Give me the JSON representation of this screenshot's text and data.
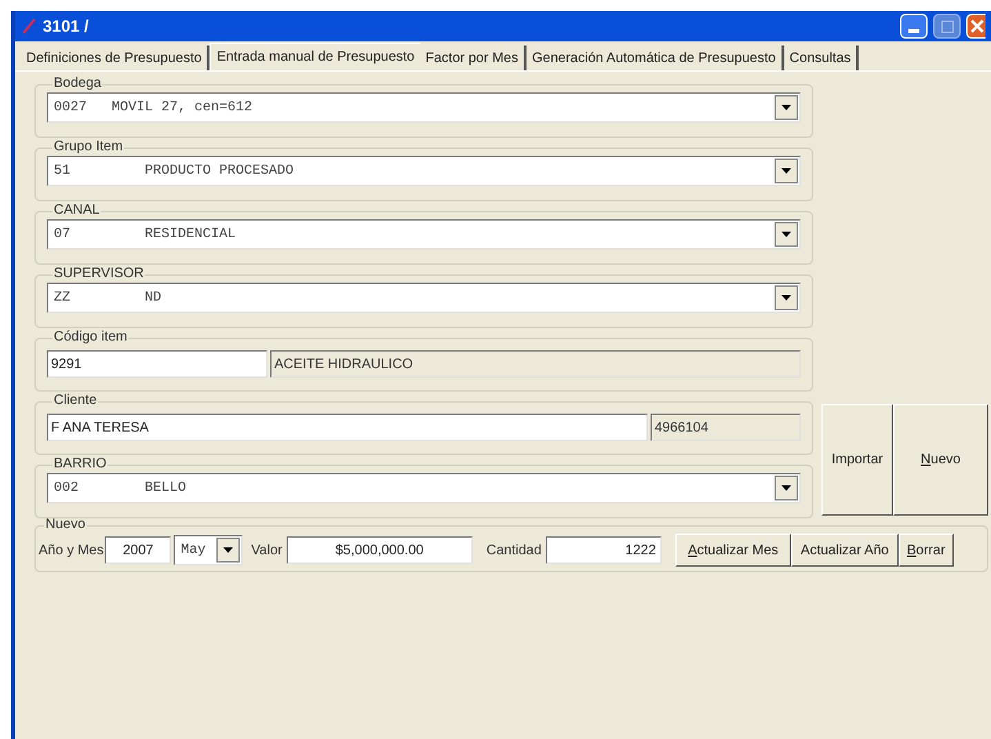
{
  "window": {
    "title": "3101 /"
  },
  "tabs": [
    {
      "label": "Definiciones de Presupuesto",
      "selected": false
    },
    {
      "label": "Entrada manual de Presupuesto",
      "selected": true
    },
    {
      "label": "Factor por Mes",
      "selected": false
    },
    {
      "label": "Generación Automática de Presupuesto",
      "selected": false
    },
    {
      "label": "Consultas",
      "selected": false
    }
  ],
  "groups": [
    {
      "kind": "combo",
      "label": "Bodega",
      "value": "0027   MOVIL 27, cen=612"
    },
    {
      "kind": "combo",
      "label": "Grupo Item",
      "value": "51         PRODUCTO PROCESADO"
    },
    {
      "kind": "combo",
      "label": "CANAL",
      "value": "07         RESIDENCIAL"
    },
    {
      "kind": "combo",
      "label": "SUPERVISOR",
      "value": "ZZ         ND"
    },
    {
      "kind": "pair",
      "label": "Código item",
      "value": "9291",
      "detail": "ACEITE HIDRAULICO",
      "wide": false
    },
    {
      "kind": "pair",
      "label": "Cliente",
      "value": "F ANA TERESA",
      "detail": "4966104",
      "wide": true
    },
    {
      "kind": "combo",
      "label": "BARRIO",
      "value": "002        BELLO"
    }
  ],
  "side_buttons": [
    {
      "rest": "Importar"
    },
    {
      "accel": "N",
      "rest": "uevo"
    }
  ],
  "nuevo": {
    "label": "Nuevo",
    "year_label": "Año y Mes",
    "year": "2007",
    "month": "May",
    "valor_label": "Valor",
    "valor": "$5,000,000.00",
    "cantidad_label": "Cantidad",
    "cantidad": "1222",
    "buttons": [
      {
        "accel": "A",
        "rest": "ctualizar Mes"
      },
      {
        "rest": "Actualizar Año"
      },
      {
        "accel": "B",
        "rest": "orrar"
      }
    ]
  }
}
